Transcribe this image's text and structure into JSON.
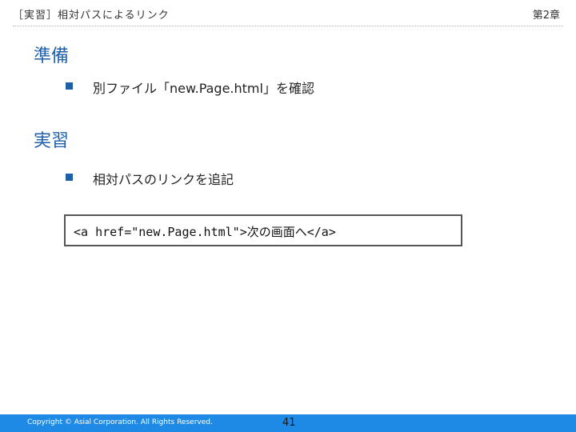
{
  "header": {
    "title": "［実習］相対パスによるリンク",
    "chapter": "第2章"
  },
  "sections": [
    {
      "heading": "準備",
      "bullet": "別ファイル「new.Page.html」を確認"
    },
    {
      "heading": "実習",
      "bullet": "相対パスのリンクを追記"
    }
  ],
  "code": "<a href=\"new.Page.html\">次の画面へ</a>",
  "footer": {
    "copyright": "Copyright © Asial Corporation. All Rights Reserved.",
    "page_number": "41"
  },
  "colors": {
    "heading": "#1f5fa8",
    "footer_bar": "#1e8ae6"
  }
}
